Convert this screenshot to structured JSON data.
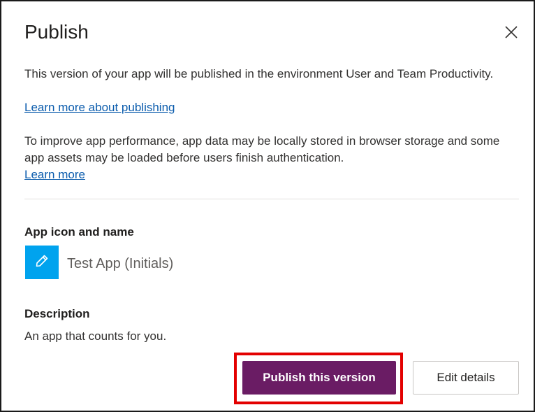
{
  "dialog": {
    "title": "Publish",
    "close_icon": "close-icon",
    "intro_text": "This version of your app will be published in the environment User and Team Productivity.",
    "learn_publishing_link": "Learn more about publishing",
    "performance_text": "To improve app performance, app data may be locally stored in browser storage and some app assets may be loaded before users finish authentication.",
    "learn_more_link": "Learn more"
  },
  "app_info": {
    "icon_label": "App icon and name",
    "icon": "pencil-icon",
    "icon_color": "#00a3ee",
    "app_name": "Test App (Initials)",
    "description_label": "Description",
    "description": "An app that counts for you."
  },
  "actions": {
    "publish_label": "Publish this version",
    "publish_color": "#6a1c64",
    "edit_label": "Edit details",
    "highlight_color": "#e30000"
  }
}
